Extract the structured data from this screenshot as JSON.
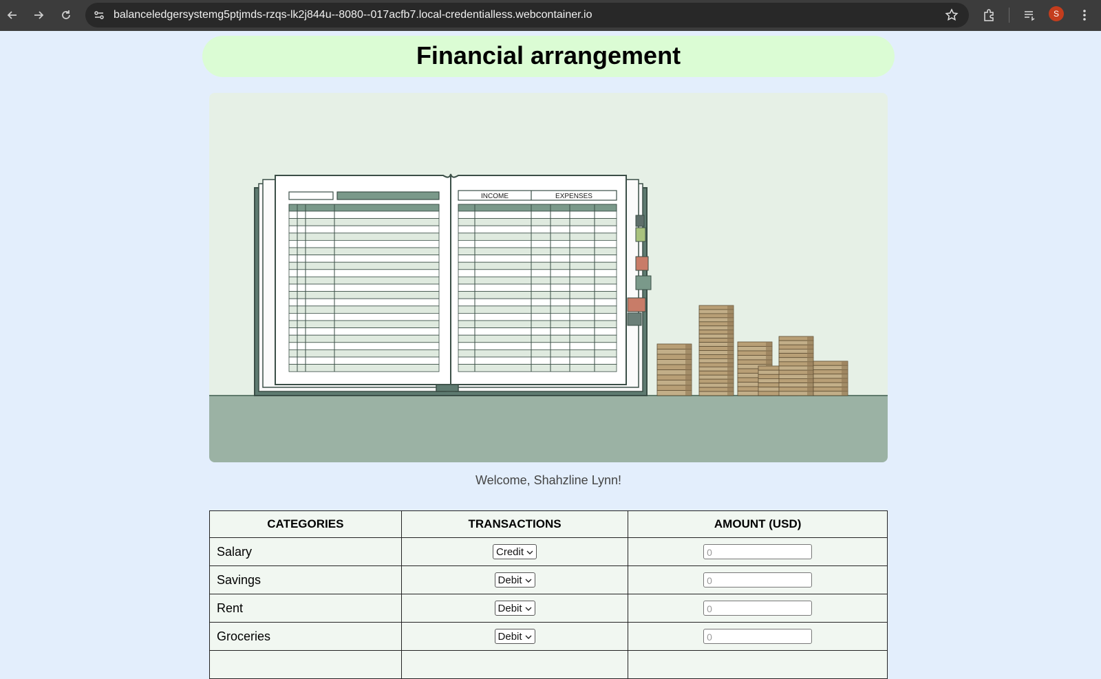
{
  "browser": {
    "url": "balanceledgersystemg5ptjmds-rzqs-lk2j844u--8080--017acfb7.local-credentialless.webcontainer.io",
    "profile_initial": "S",
    "icons": [
      "back-arrow-icon",
      "forward-arrow-icon",
      "reload-icon",
      "site-settings-icon",
      "bookmark-star-icon",
      "extensions-icon",
      "reading-list-icon",
      "menu-icon"
    ]
  },
  "page": {
    "title": "Financial arrangement",
    "welcome": "Welcome, Shahzline Lynn!"
  },
  "illustration": {
    "income_label": "INCOME",
    "expenses_label": "EXPENSES"
  },
  "table": {
    "headers": [
      "CATEGORIES",
      "TRANSACTIONS",
      "AMOUNT (USD)"
    ],
    "rows": [
      {
        "category": "Salary",
        "transaction": "Credit",
        "amount_placeholder": "0"
      },
      {
        "category": "Savings",
        "transaction": "Debit",
        "amount_placeholder": "0"
      },
      {
        "category": "Rent",
        "transaction": "Debit",
        "amount_placeholder": "0"
      },
      {
        "category": "Groceries",
        "transaction": "Debit",
        "amount_placeholder": "0"
      }
    ]
  },
  "colors": {
    "page_bg": "#e3eefc",
    "banner_bg": "#dbfcd4",
    "table_bg": "#f1f7f1",
    "ledger_green": "#7a998a",
    "desk": "#9bb2a4"
  }
}
